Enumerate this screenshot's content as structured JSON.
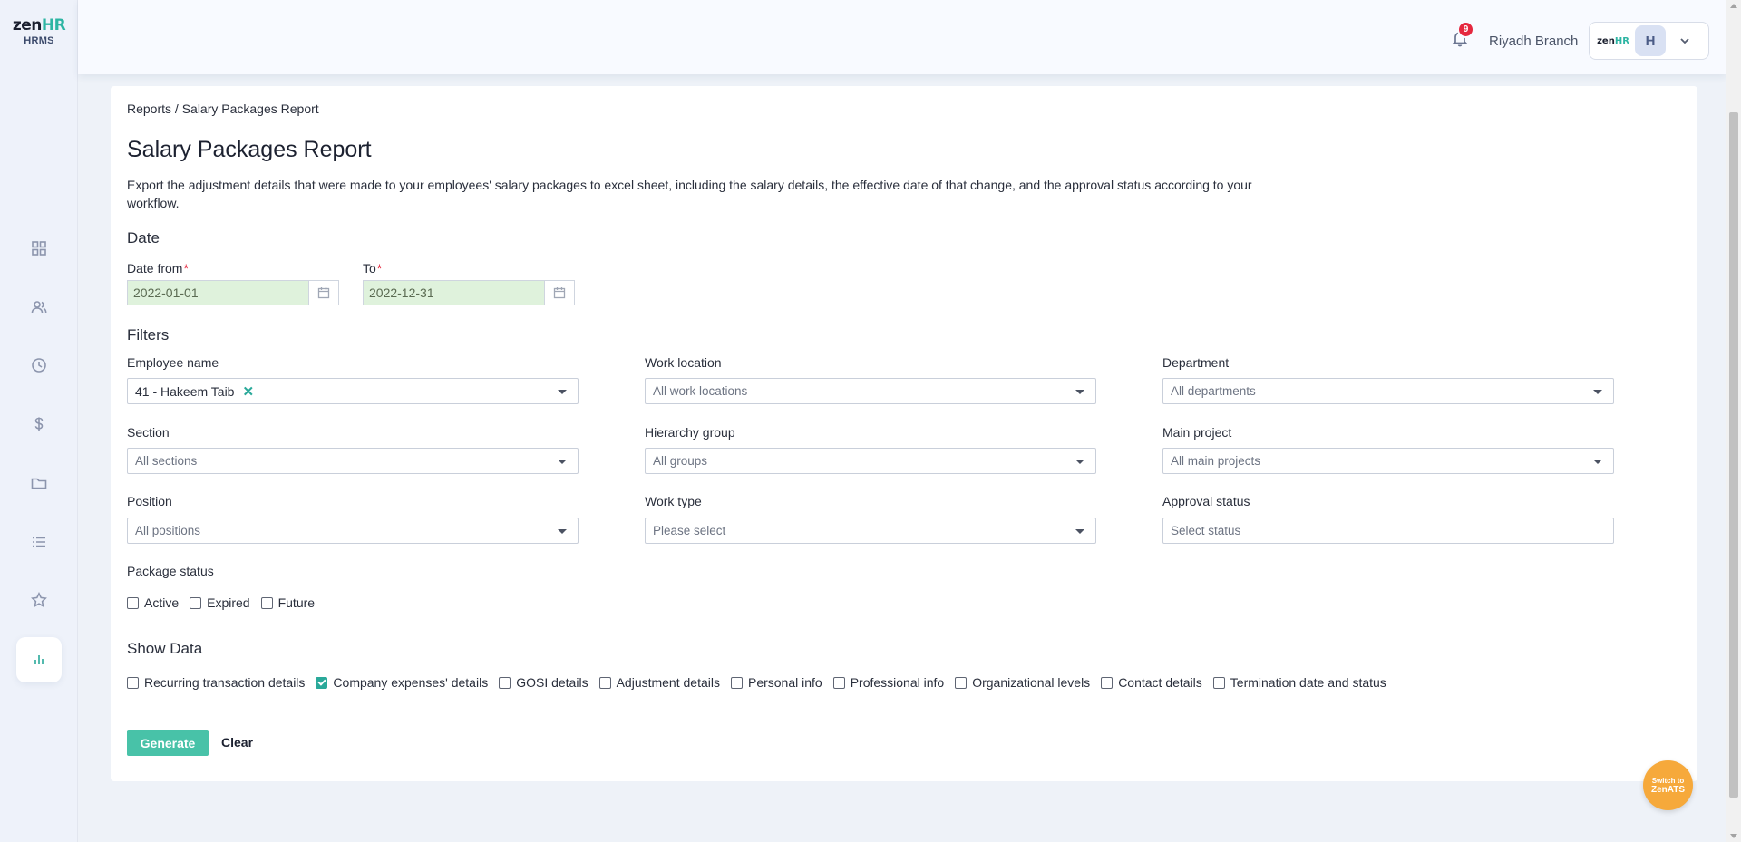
{
  "brand": {
    "logo_zen": "zen",
    "logo_hr": "HR",
    "logo_sub": "HRMS"
  },
  "sidebar": {
    "items": [
      {
        "name": "dashboard",
        "icon": "grid-icon"
      },
      {
        "name": "employees",
        "icon": "users-icon"
      },
      {
        "name": "attendance",
        "icon": "clock-icon"
      },
      {
        "name": "payroll",
        "icon": "dollar-icon"
      },
      {
        "name": "documents",
        "icon": "folder-icon"
      },
      {
        "name": "lists",
        "icon": "list-icon"
      },
      {
        "name": "favorites",
        "icon": "star-icon"
      },
      {
        "name": "reports",
        "icon": "bar-chart-icon",
        "active": true
      }
    ]
  },
  "header": {
    "notification_count": "9",
    "branch": "Riyadh Branch",
    "company_logo_zen": "zen",
    "company_logo_hr": "HR",
    "avatar_initial": "H"
  },
  "breadcrumb": "Reports / Salary Packages Report",
  "page": {
    "title": "Salary Packages Report",
    "description": "Export the adjustment details that were made to your employees' salary packages to excel sheet, including the salary details, the effective date of that change, and the approval status according to your workflow."
  },
  "date_section": {
    "title": "Date",
    "from_label": "Date from",
    "from_value": "2022-01-01",
    "to_label": "To",
    "to_value": "2022-12-31",
    "required_mark": "*"
  },
  "filters": {
    "title": "Filters",
    "employee_name": {
      "label": "Employee name",
      "selected": "41 - Hakeem Taib",
      "remove": "✕"
    },
    "work_location": {
      "label": "Work location",
      "placeholder": "All work locations"
    },
    "department": {
      "label": "Department",
      "placeholder": "All departments"
    },
    "section": {
      "label": "Section",
      "placeholder": "All sections"
    },
    "hierarchy_group": {
      "label": "Hierarchy group",
      "placeholder": "All groups"
    },
    "main_project": {
      "label": "Main project",
      "placeholder": "All main projects"
    },
    "position": {
      "label": "Position",
      "placeholder": "All positions"
    },
    "work_type": {
      "label": "Work type",
      "placeholder": "Please select"
    },
    "approval_status": {
      "label": "Approval status",
      "placeholder": "Select status"
    }
  },
  "package_status": {
    "title": "Package status",
    "options": [
      {
        "label": "Active",
        "checked": false
      },
      {
        "label": "Expired",
        "checked": false
      },
      {
        "label": "Future",
        "checked": false
      }
    ]
  },
  "show_data": {
    "title": "Show Data",
    "options": [
      {
        "label": "Recurring transaction details",
        "checked": false
      },
      {
        "label": "Company expenses' details",
        "checked": true
      },
      {
        "label": "GOSI details",
        "checked": false
      },
      {
        "label": "Adjustment details",
        "checked": false
      },
      {
        "label": "Personal info",
        "checked": false
      },
      {
        "label": "Professional info",
        "checked": false
      },
      {
        "label": "Organizational levels",
        "checked": false
      },
      {
        "label": "Contact details",
        "checked": false
      },
      {
        "label": "Termination date and status",
        "checked": false
      }
    ]
  },
  "actions": {
    "generate": "Generate",
    "clear": "Clear"
  },
  "switch_ats": {
    "line1": "Switch to",
    "line2": "ZenATS"
  },
  "colors": {
    "accent": "#2aa99a",
    "generate_button": "#48c2a8",
    "badge": "#e5283f",
    "switch_ats": "#f6a93b"
  }
}
